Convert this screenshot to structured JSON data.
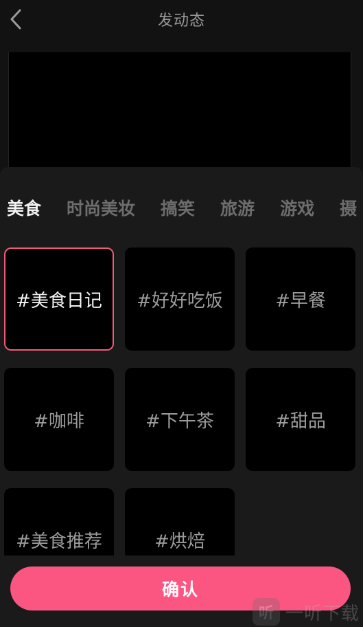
{
  "header": {
    "title": "发动态",
    "back_icon": "chevron-left-icon"
  },
  "composer": {
    "text": ""
  },
  "tabs": [
    {
      "label": "美食",
      "active": true
    },
    {
      "label": "时尚美妆",
      "active": false
    },
    {
      "label": "搞笑",
      "active": false
    },
    {
      "label": "旅游",
      "active": false
    },
    {
      "label": "游戏",
      "active": false
    },
    {
      "label": "摄",
      "active": false
    }
  ],
  "tags": [
    {
      "label": "#美食日记",
      "selected": true
    },
    {
      "label": "#好好吃饭",
      "selected": false
    },
    {
      "label": "#早餐",
      "selected": false
    },
    {
      "label": "#咖啡",
      "selected": false
    },
    {
      "label": "#下午茶",
      "selected": false
    },
    {
      "label": "#甜品",
      "selected": false
    },
    {
      "label": "#美食推荐",
      "selected": false
    },
    {
      "label": "#烘焙",
      "selected": false
    }
  ],
  "confirm": {
    "label": "确认"
  },
  "watermark": {
    "logo_char": "听",
    "text": "一听下载"
  },
  "colors": {
    "background": "#121212",
    "accent": "#fb5582",
    "selected_border": "#f3597a"
  }
}
